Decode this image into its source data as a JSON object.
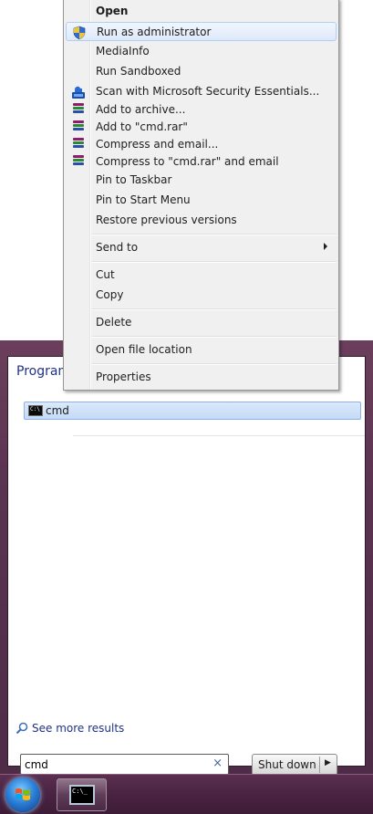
{
  "context_menu": {
    "items": [
      {
        "label": "Open",
        "icon": null
      },
      {
        "label": "Run as administrator",
        "icon": "uac-shield-icon"
      },
      {
        "label": "MediaInfo",
        "icon": null
      },
      {
        "label": "Run Sandboxed",
        "icon": null
      },
      {
        "label": "Scan with Microsoft Security Essentials...",
        "icon": "security-essentials-icon"
      },
      {
        "label": "Add to archive...",
        "icon": "winrar-icon"
      },
      {
        "label": "Add to \"cmd.rar\"",
        "icon": "winrar-icon"
      },
      {
        "label": "Compress and email...",
        "icon": "winrar-icon"
      },
      {
        "label": "Compress to \"cmd.rar\" and email",
        "icon": "winrar-icon"
      },
      {
        "label": "Pin to Taskbar",
        "icon": null
      },
      {
        "label": "Pin to Start Menu",
        "icon": null
      },
      {
        "label": "Restore previous versions",
        "icon": null
      },
      {
        "label": "Send to",
        "icon": null,
        "submenu": true
      },
      {
        "label": "Cut",
        "icon": null
      },
      {
        "label": "Copy",
        "icon": null
      },
      {
        "label": "Delete",
        "icon": null
      },
      {
        "label": "Open file location",
        "icon": null
      },
      {
        "label": "Properties",
        "icon": null
      }
    ],
    "highlighted": "Run as administrator",
    "default_item": "Open"
  },
  "start_menu": {
    "group_header": "Program",
    "results": [
      {
        "label": "cmd",
        "icon": "command-prompt-icon"
      }
    ],
    "see_more": "See more results",
    "search": {
      "value": "cmd",
      "clear": "×"
    },
    "shutdown_label": "Shut down",
    "shutdown_arrow": "▶"
  },
  "taskbar": {
    "start_orb": "windows-start-orb",
    "items": [
      {
        "icon": "command-prompt-icon",
        "prompt_text": "C:\\_"
      }
    ]
  },
  "colors": {
    "accent_link": "#1e3287",
    "highlight_bg": "#dde9f9",
    "highlight_border": "#aecff7",
    "taskbar": "#4a2342"
  }
}
